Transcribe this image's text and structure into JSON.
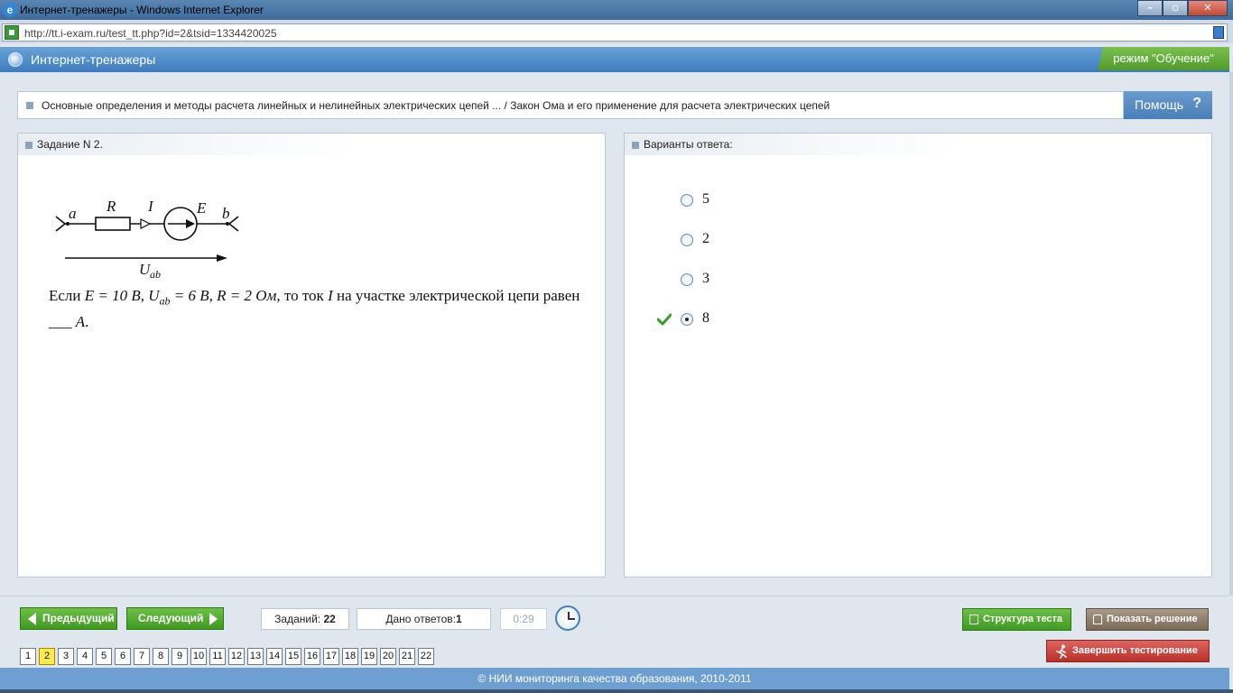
{
  "window": {
    "title": "Интернет-тренажеры - Windows Internet Explorer",
    "address": "http://tt.i-exam.ru/test_tt.php?id=2&tsid=1334420025"
  },
  "app": {
    "title": "Интернет-тренажеры",
    "mode": "режим \"Обучение\""
  },
  "breadcrumb": {
    "text": "Основные определения и методы расчета линейных и нелинейных электрических цепей ... / Закон Ома и его применение для расчета электрических цепей",
    "help_label": "Помощь",
    "help_mark": "?"
  },
  "task": {
    "title": "Задание N 2.",
    "circuit": {
      "node_a": "a",
      "resistor": "R",
      "current": "I",
      "source": "E",
      "node_b": "b",
      "voltage": "U",
      "voltage_sub": "ab"
    },
    "text": {
      "p1": "Если",
      "e_eq": "E = 10 В",
      "c1": ",",
      "u_main": "U",
      "u_sub": "ab",
      "u_eq": " = 6 В",
      "c2": ",",
      "r_eq": "R = 2 Ом",
      "p2": ", то ток",
      "i_sym": "I",
      "p3": "на участке электрической цепи равен ___",
      "unit": "А",
      "dot": "."
    }
  },
  "answers": {
    "title": "Варианты ответа:",
    "options": [
      {
        "value": "5",
        "checked": false
      },
      {
        "value": "2",
        "checked": false
      },
      {
        "value": "3",
        "checked": false
      },
      {
        "value": "8",
        "checked": true
      }
    ]
  },
  "nav": {
    "prev_label": "Предыдущий",
    "next_label": "Следующий",
    "tasks_label": "Заданий:",
    "tasks_count": "22",
    "answers_label": "Дано ответов:",
    "answers_count": "1",
    "timer": "0:29",
    "structure_label": "Структура теста",
    "solution_label": "Показать решение",
    "finish_label": "Завершить тестирование",
    "current_page": "2",
    "pages": [
      "1",
      "2",
      "3",
      "4",
      "5",
      "6",
      "7",
      "8",
      "9",
      "10",
      "11",
      "12",
      "13",
      "14",
      "15",
      "16",
      "17",
      "18",
      "19",
      "20",
      "21",
      "22"
    ]
  },
  "footer": {
    "text": "© НИИ мониторинга качества образования, 2010-2011"
  },
  "colors": {
    "header": "#3d7cc0",
    "accent_green": "#4f9a2b",
    "help": "#4a7fb8",
    "finish": "#b8302a",
    "current_page": "#ffe94a"
  }
}
